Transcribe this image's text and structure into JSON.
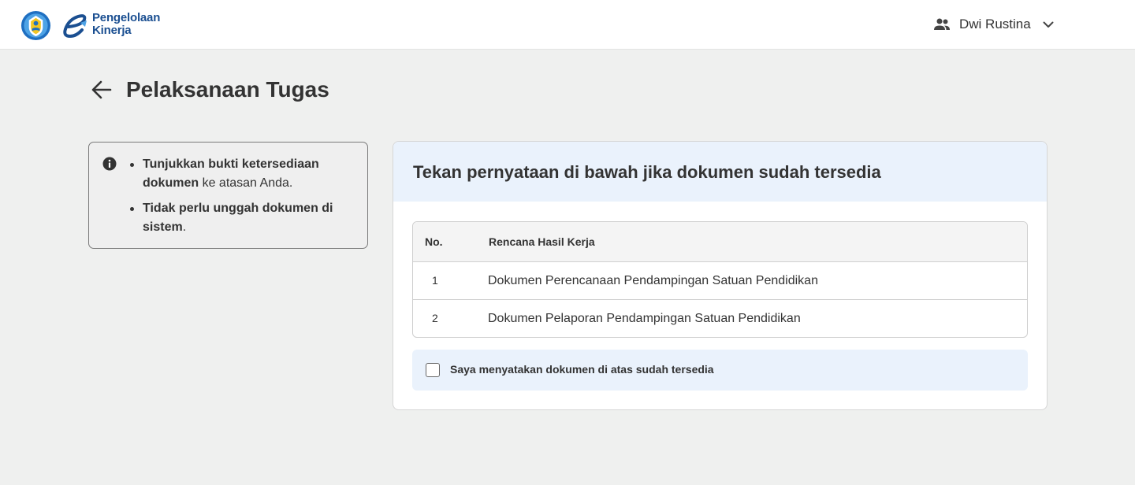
{
  "header": {
    "logo_text_line1": "Pengelolaan",
    "logo_text_line2": "Kinerja",
    "user_name": "Dwi Rustina",
    "user_icon": "people-icon",
    "menu_icon": "chevron-down-icon"
  },
  "page": {
    "title": "Pelaksanaan Tugas",
    "back_icon": "arrow-left-icon"
  },
  "info": {
    "icon": "info-circle-icon",
    "item1_bold": "Tunjukkan bukti ketersediaan dokumen",
    "item1_rest": " ke atasan Anda.",
    "item2_bold": "Tidak perlu unggah dokumen di sistem",
    "item2_rest": "."
  },
  "card": {
    "title": "Tekan pernyataan di bawah jika dokumen sudah tersedia",
    "table": {
      "headers": [
        "No.",
        "Rencana Hasil Kerja"
      ],
      "rows": [
        {
          "no": "1",
          "rhk": "Dokumen Perencanaan Pendampingan Satuan Pendidikan"
        },
        {
          "no": "2",
          "rhk": "Dokumen Pelaporan Pendampingan Satuan Pendidikan"
        }
      ]
    },
    "confirm_label": "Saya menyatakan dokumen di atas sudah tersedia",
    "confirm_checked": false
  },
  "colors": {
    "brand_blue": "#1b4f91",
    "card_header_bg": "#eaf2fc",
    "page_bg": "#eff0ef"
  }
}
